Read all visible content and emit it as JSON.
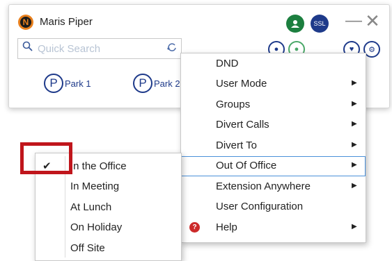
{
  "app": {
    "user_name": "Maris Piper",
    "logo_letter": "N",
    "ssl_label": "SSL"
  },
  "search": {
    "placeholder": "Quick Search"
  },
  "parks": [
    {
      "icon_letter": "P",
      "label": "Park 1"
    },
    {
      "icon_letter": "P",
      "label": "Park 2"
    }
  ],
  "menu": {
    "items": [
      {
        "label": "DND",
        "submenu": false
      },
      {
        "label": "User Mode",
        "submenu": true
      },
      {
        "label": "Groups",
        "submenu": true
      },
      {
        "label": "Divert Calls",
        "submenu": true
      },
      {
        "label": "Divert To",
        "submenu": true
      },
      {
        "label": "Out Of Office",
        "submenu": true,
        "highlighted": true
      },
      {
        "label": "Extension Anywhere",
        "submenu": true
      },
      {
        "label": "User Configuration",
        "submenu": false
      },
      {
        "label": "Help",
        "submenu": true,
        "icon": "help-icon"
      }
    ],
    "arrow_glyph": "▶"
  },
  "out_of_office": {
    "items": [
      {
        "label": "In the Office",
        "checked": true
      },
      {
        "label": "In Meeting",
        "checked": false
      },
      {
        "label": "At Lunch",
        "checked": false
      },
      {
        "label": "On Holiday",
        "checked": false
      },
      {
        "label": "Off Site",
        "checked": false
      }
    ],
    "check_glyph": "✔"
  },
  "colors": {
    "accent": "#1e3a8a",
    "presence_green": "#1c7f3f",
    "annotation_red": "#c0161c",
    "highlight_border": "#4a90d9"
  }
}
